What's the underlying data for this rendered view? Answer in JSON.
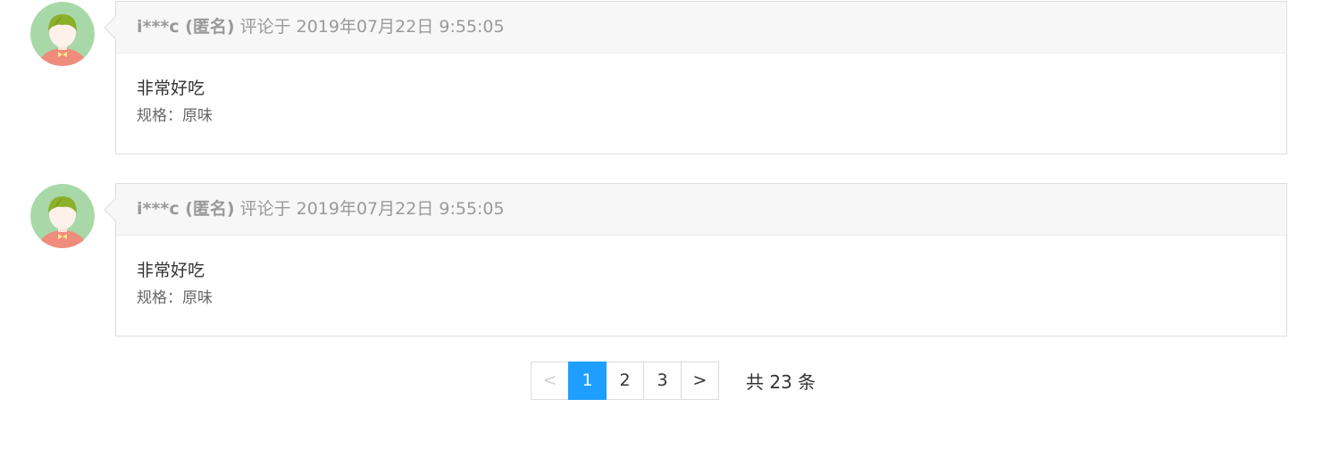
{
  "comments": [
    {
      "user": "i***c (匿名)",
      "meta": "评论于 2019年07月22日 9:55:05",
      "text": "非常好吃",
      "spec": "规格：原味"
    },
    {
      "user": "i***c (匿名)",
      "meta": "评论于 2019年07月22日 9:55:05",
      "text": "非常好吃",
      "spec": "规格：原味"
    }
  ],
  "pagination": {
    "prev": "<",
    "pages": [
      "1",
      "2",
      "3"
    ],
    "current": "1",
    "next": ">",
    "total": "共 23 条"
  },
  "colors": {
    "accent": "#1e9fff",
    "avatar_bg": "#a8d8a8",
    "avatar_hair": "#8bb02a",
    "avatar_shirt": "#f08c7c"
  },
  "icons": {
    "avatar": "user-avatar-icon"
  }
}
